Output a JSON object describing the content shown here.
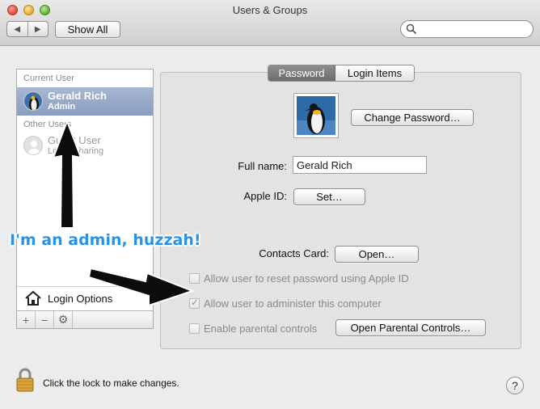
{
  "window": {
    "title": "Users & Groups",
    "show_all_label": "Show All",
    "back_glyph": "◀",
    "forward_glyph": "▶",
    "search_placeholder": ""
  },
  "sidebar": {
    "current_user_header": "Current User",
    "current_user": {
      "name": "Gerald Rich",
      "role": "Admin"
    },
    "other_users_header": "Other Users",
    "guest_user": {
      "name": "Guest User",
      "role": "Login, sharing"
    },
    "login_options_label": "Login Options",
    "toolbar": {
      "add": "+",
      "remove": "−",
      "gear": "⚙"
    }
  },
  "tabs": [
    {
      "label": "Password",
      "active": true
    },
    {
      "label": "Login Items",
      "active": false
    }
  ],
  "main": {
    "change_password_label": "Change Password…",
    "full_name_label": "Full name:",
    "full_name_value": "Gerald Rich",
    "apple_id_label": "Apple ID:",
    "apple_id_button": "Set…",
    "contacts_card_label": "Contacts Card:",
    "contacts_card_button": "Open…",
    "checkboxes": [
      {
        "label": "Allow user to reset password using Apple ID",
        "checked": false
      },
      {
        "label": "Allow user to administer this computer",
        "checked": true
      },
      {
        "label": "Enable parental controls",
        "checked": false
      }
    ],
    "open_parental_controls_label": "Open Parental Controls…"
  },
  "annotation": {
    "text": "I'm an admin, huzzah!",
    "color": "#2a93e6"
  },
  "footer": {
    "lock_text": "Click the lock to make changes.",
    "help_glyph": "?"
  },
  "colors": {
    "selection": "#8a9dc0",
    "panel_bg": "#e3e3e3",
    "window_bg": "#ececec"
  }
}
